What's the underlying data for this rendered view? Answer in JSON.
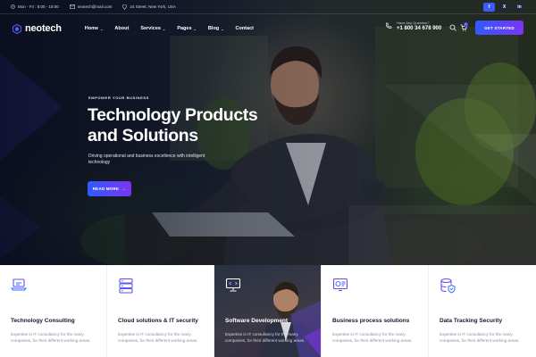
{
  "topbar": {
    "hours": "Mon - Fri : 8:00 - 18:00",
    "email": "neotech@mail.com",
    "address": "24 Street, New York, USA",
    "socials": [
      {
        "icon": "facebook-icon",
        "glyph": "f",
        "color": "#3b5bfd"
      },
      {
        "icon": "x-icon",
        "glyph": "X",
        "color": "#1e2638"
      },
      {
        "icon": "linkedin-icon",
        "glyph": "in",
        "color": "#1e2638"
      }
    ]
  },
  "nav": {
    "logo": "neotech",
    "items": [
      {
        "label": "Home",
        "dropdown": true
      },
      {
        "label": "About",
        "dropdown": false
      },
      {
        "label": "Services",
        "dropdown": true
      },
      {
        "label": "Pages",
        "dropdown": true
      },
      {
        "label": "Blog",
        "dropdown": true
      },
      {
        "label": "Contact",
        "dropdown": false
      }
    ],
    "help_question": "Have Any Question?",
    "help_phone": "+1 800 34 678 900",
    "cta": "GET STARTED",
    "cart_count": "0"
  },
  "hero": {
    "eyebrow": "EMPOWER YOUR BUSINESS",
    "title_line1": "Technology Products",
    "title_line2": "and Solutions",
    "subtitle": "Driving operational and business excellence with intelligent technology",
    "button": "READ MORE"
  },
  "services": [
    {
      "title": "Technology Consulting",
      "desc": "Expertise in IT consultancy for the many companies, for their different working areas.",
      "icon": "laptop-icon",
      "active": false
    },
    {
      "title": "Cloud solutions & IT security",
      "desc": "Expertise in IT consultancy for the many companies, for their different working areas.",
      "icon": "server-icon",
      "active": false
    },
    {
      "title": "Software Development",
      "desc": "Expertise in IT consultancy for the many companies, for their different working areas.",
      "icon": "monitor-code-icon",
      "active": true
    },
    {
      "title": "Business process solutions",
      "desc": "Expertise in IT consultancy for the many companies, for their different working areas.",
      "icon": "dashboard-icon",
      "active": false
    },
    {
      "title": "Data Tracking Security",
      "desc": "Expertise in IT consultancy for the many companies, for their different working areas.",
      "icon": "database-shield-icon",
      "active": false
    }
  ],
  "colors": {
    "accent_start": "#2f5bff",
    "accent_end": "#7b35f0",
    "icon_purple": "#6d4ae8",
    "icon_blue": "#3b6bff"
  }
}
